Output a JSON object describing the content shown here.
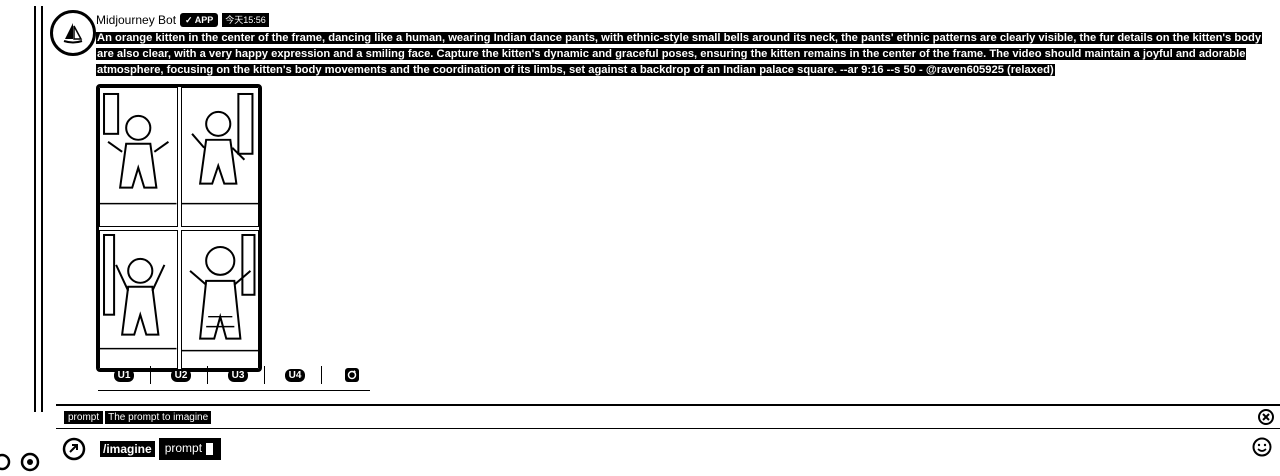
{
  "message": {
    "bot_name": "Midjourney Bot",
    "badge": "✓ APP",
    "timestamp": "今天15:56",
    "prompt": "An orange kitten in the center of the frame, dancing like a human, wearing Indian dance pants, with ethnic-style small bells around its neck, the pants' ethnic patterns are clearly visible, the fur details on the kitten's body are also clear, with a very happy expression and a smiling face. Capture the kitten's dynamic and graceful poses, ensuring the kitten remains in the center of the frame. The video should maintain a joyful and adorable atmosphere, focusing on the kitten's body movements and the coordination of its limbs, set against a backdrop of an Indian palace square. --ar 9:16 --s 50 - @raven605925 (relaxed)"
  },
  "buttons": {
    "u1": "U1",
    "u2": "U2",
    "u3": "U3",
    "u4": "U4"
  },
  "option_hint": {
    "name": "prompt",
    "description": "The prompt to imagine"
  },
  "composer": {
    "command": "/imagine",
    "param": "prompt"
  },
  "icons": {
    "avatar": "sailboat-icon",
    "reroll": "refresh-icon",
    "close": "close-icon",
    "emoji": "smile-icon",
    "attach": "plus-circle-icon",
    "settings": "gear-icon"
  }
}
